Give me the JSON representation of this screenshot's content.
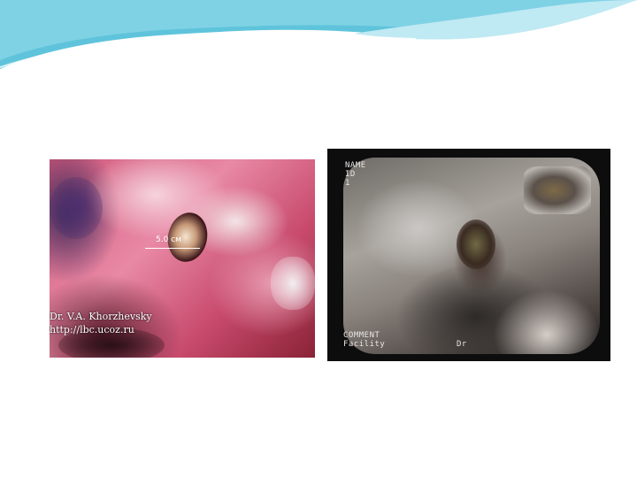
{
  "left_photo": {
    "measurement": "5.0 см",
    "credit_name": "Dr. V.A. Khorzhevsky",
    "credit_url": "http://lbc.ucoz.ru"
  },
  "right_photo": {
    "osd_top_left": [
      "NAME",
      "ID",
      "1"
    ],
    "osd_bottom_left": [
      "COMMENT",
      "Facility"
    ],
    "osd_bottom_right": "Dr"
  }
}
